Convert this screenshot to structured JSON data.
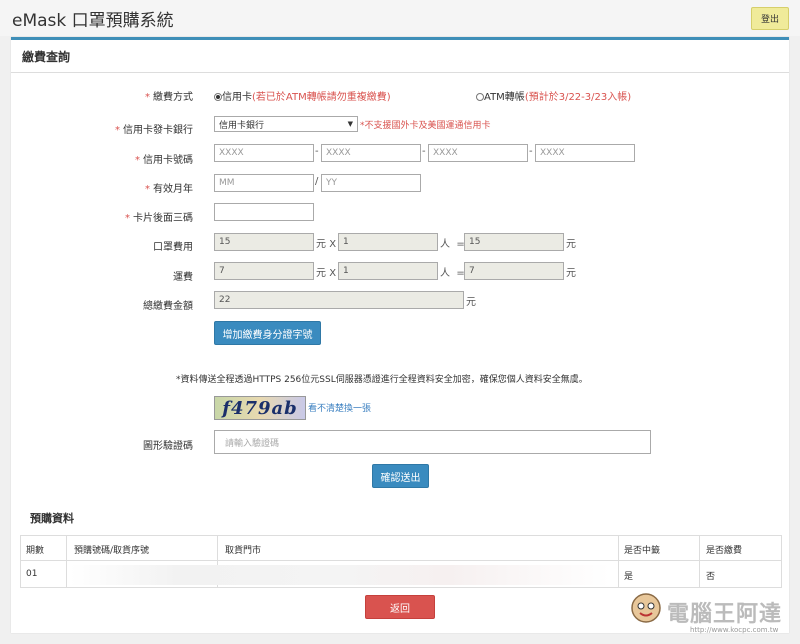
{
  "app": {
    "title": "eMask 口罩預購系統",
    "logout": "登出"
  },
  "panel": {
    "title": "繳費查詢"
  },
  "form": {
    "payment_method": {
      "label": "繳費方式",
      "option_card": "信用卡",
      "option_card_note": "(若已於ATM轉帳請勿重複繳費)",
      "option_atm": "ATM轉帳",
      "option_atm_note": "(預計於3/22-3/23入帳)"
    },
    "bank": {
      "label": "信用卡發卡銀行",
      "selected": "信用卡銀行",
      "note": "*不支援國外卡及美國運通信用卡"
    },
    "card_number": {
      "label": "信用卡號碼",
      "placeholder": "XXXX"
    },
    "expiry": {
      "label": "有效月年",
      "month_placeholder": "MM",
      "year_placeholder": "YY",
      "sep": "/"
    },
    "cvv": {
      "label": "卡片後面三碼"
    },
    "mask_fee": {
      "label": "口罩費用",
      "unit_price": "15",
      "qty": "1",
      "total": "15"
    },
    "shipping": {
      "label": "運費",
      "unit_price": "7",
      "qty": "1",
      "total": "7"
    },
    "total_fee": {
      "label": "總繳費金額",
      "value": "22"
    },
    "units": {
      "yuan": "元",
      "x": "X",
      "person": "人",
      "eq": "="
    },
    "add_id_button": "增加繳費身分證字號",
    "security_note": "*資料傳送全程透過HTTPS 256位元SSL伺服器憑證進行全程資料安全加密，確保您個人資料安全無虞。",
    "captcha": {
      "image_text": "f479ab",
      "refresh": "看不清楚換一張",
      "label": "圖形驗證碼",
      "placeholder": "請輸入驗證碼"
    },
    "submit": "確認送出",
    "required_mark": "*"
  },
  "preorder": {
    "title": "預購資料",
    "headers": [
      "期數",
      "預購號碼/取貨序號",
      "取貨門市",
      "是否中籤",
      "是否繳費"
    ],
    "rows": [
      {
        "period": "01",
        "number": "",
        "store": "",
        "won": "是",
        "paid": "否"
      }
    ]
  },
  "back_button": "返回",
  "watermark": {
    "text": "電腦王阿達",
    "url": "http://www.kocpc.com.tw"
  }
}
